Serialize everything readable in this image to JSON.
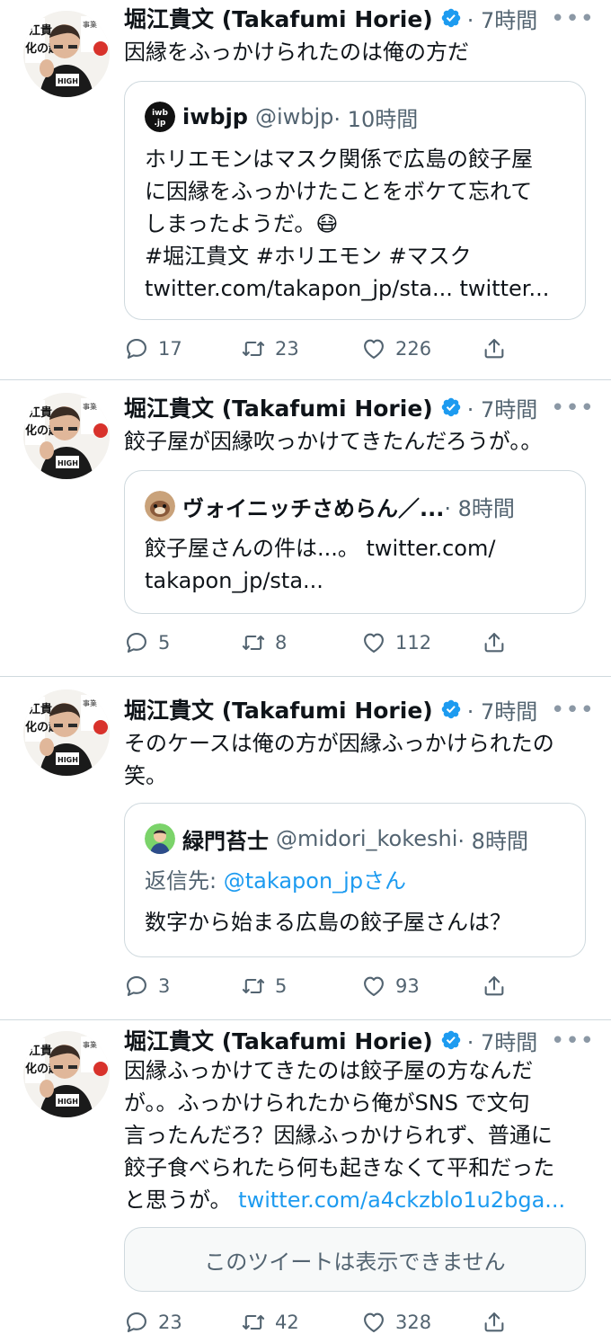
{
  "tweets": [
    {
      "author_name": "堀江貴文 (Takafumi Horie)",
      "time": "· 7時間",
      "text": "因縁をふっかけられたのは俺の方だ",
      "quote": {
        "name": "iwbjp",
        "handle": "@iwbjp",
        "time": "· 10時間",
        "text_lines": [
          "ホリエモンはマスク関係で広島の餃子屋",
          "に因縁をふっかけたことをボケて忘れて",
          "しまったようだ。😷",
          "#堀江貴文 #ホリエモン #マスク",
          "twitter.com/takapon_jp/sta... twitter..."
        ]
      },
      "replies": "17",
      "retweets": "23",
      "likes": "226"
    },
    {
      "author_name": "堀江貴文 (Takafumi Horie)",
      "time": "· 7時間",
      "text": "餃子屋が因縁吹っかけてきたんだろうが。。",
      "quote": {
        "name": "ヴォイニッチさめらん／...",
        "handle": "",
        "time": "· 8時間",
        "text_lines": [
          "餃子屋さんの件は...。 twitter.com/",
          "takapon_jp/sta..."
        ]
      },
      "replies": "5",
      "retweets": "8",
      "likes": "112"
    },
    {
      "author_name": "堀江貴文 (Takafumi Horie)",
      "time": "· 7時間",
      "text_lines": [
        "そのケースは俺の方が因縁ふっかけられたの",
        "笑。"
      ],
      "quote": {
        "name": "緑門苔士",
        "handle": "@midori_kokeshi",
        "time": "· 8時間",
        "reply_prefix": "返信先: ",
        "reply_to": "@takapon_jpさん",
        "text_lines": [
          "数字から始まる広島の餃子屋さんは？"
        ]
      },
      "replies": "3",
      "retweets": "5",
      "likes": "93"
    },
    {
      "author_name": "堀江貴文 (Takafumi Horie)",
      "time": "· 7時間",
      "text_lines": [
        "因縁ふっかけてきたのは餃子屋の方なんだ",
        "が。。ふっかけられたから俺がSNS で文句",
        "言ったんだろ？因縁ふっかけられず、普通に",
        "餃子食べられたら何も起きなくて平和だった",
        "と思うが。"
      ],
      "link": "twitter.com/a4ckzblo1u2bga...",
      "unavailable": "このツイートは表示できません",
      "replies": "23",
      "retweets": "42",
      "likes": "328"
    }
  ],
  "icons": {
    "verified": "verified-badge-icon",
    "more": "more-dots-icon",
    "reply": "reply-bubble-icon",
    "retweet": "retweet-icon",
    "like": "heart-icon",
    "share": "share-icon"
  },
  "more_glyph": "•••",
  "colors": {
    "accent": "#1d9bf0",
    "muted": "#536471",
    "border": "#cfd9de"
  }
}
